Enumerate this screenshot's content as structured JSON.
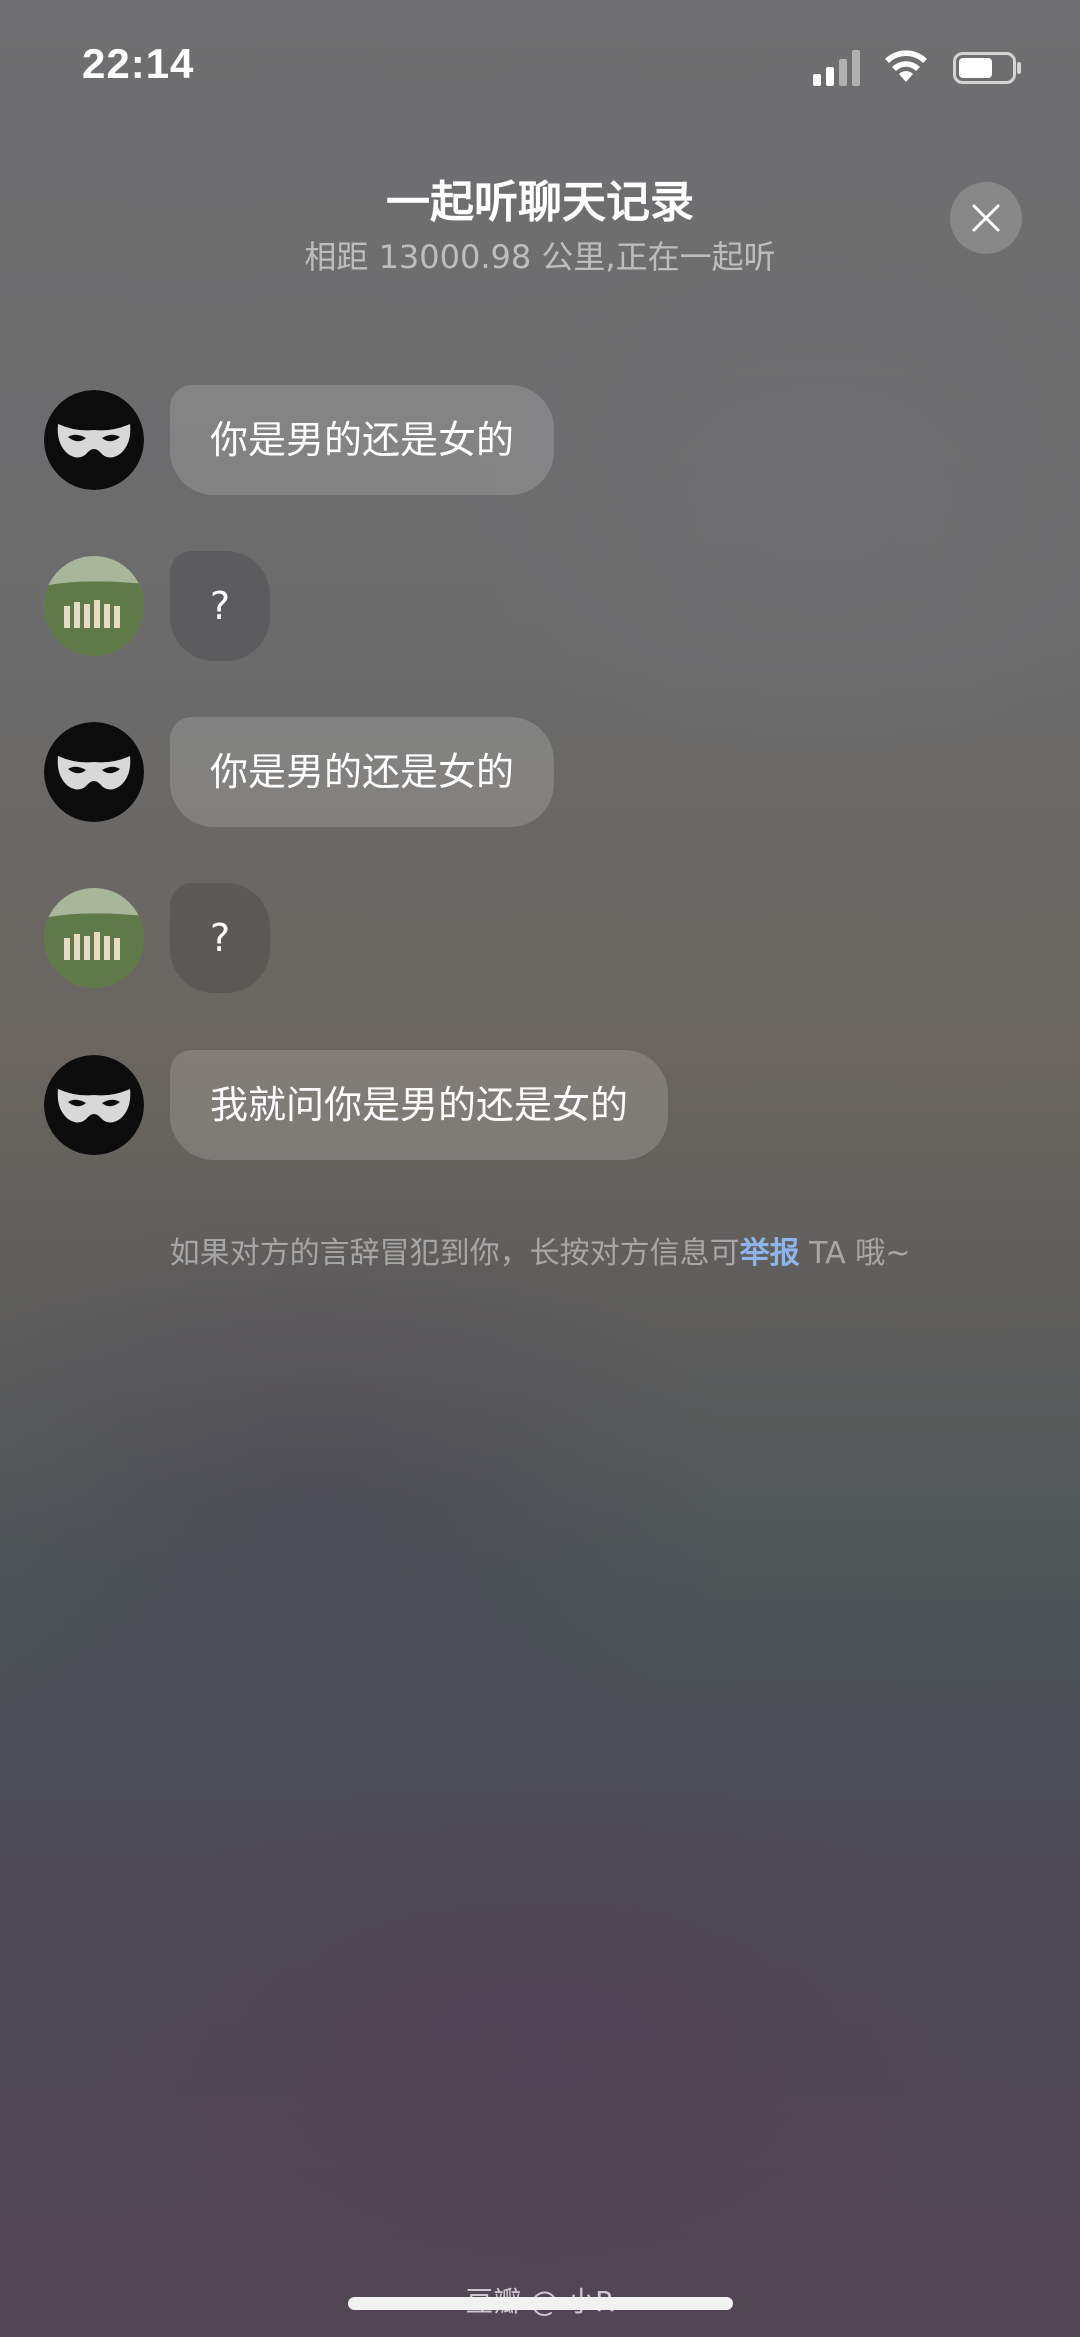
{
  "status_bar": {
    "time": "22:14",
    "icons": [
      "signal-icon",
      "wifi-icon",
      "battery-icon"
    ]
  },
  "header": {
    "title": "一起听聊天记录",
    "subtitle": "相距 13000.98 公里,正在一起听",
    "close_icon": "close-icon"
  },
  "messages": [
    {
      "sender": "mask-avatar",
      "text": "你是男的还是女的"
    },
    {
      "sender": "landscape-avatar",
      "text": "?"
    },
    {
      "sender": "mask-avatar",
      "text": "你是男的还是女的"
    },
    {
      "sender": "landscape-avatar",
      "text": "?"
    },
    {
      "sender": "mask-avatar",
      "text": "我就问你是男的还是女的"
    }
  ],
  "notice": {
    "prefix": "如果对方的言辞冒犯到你，长按对方信息可",
    "link": "举报",
    "suffix": " TA 哦~"
  },
  "watermark": "豆瓣 @ 小R",
  "colors": {
    "link": "#8fb4ea",
    "background_top": "#6f6f71",
    "background_bottom": "#524655"
  }
}
